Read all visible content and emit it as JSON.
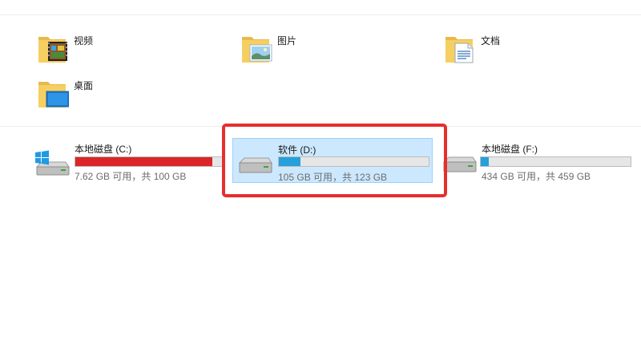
{
  "folders": [
    {
      "label": "视频",
      "icon": "video-folder-icon"
    },
    {
      "label": "图片",
      "icon": "pictures-folder-icon"
    },
    {
      "label": "文档",
      "icon": "documents-folder-icon"
    },
    {
      "label": "桌面",
      "icon": "desktop-folder-icon"
    }
  ],
  "drives": [
    {
      "name": "本地磁盘 (C:)",
      "free_text": "7.62 GB 可用，共 100 GB",
      "used_fraction": 0.924,
      "bar_color": "#da2626",
      "icon": "windows-drive-icon"
    },
    {
      "name": "软件 (D:)",
      "free_text": "105 GB 可用，共 123 GB",
      "used_fraction": 0.146,
      "bar_color": "#26a0da",
      "icon": "hard-drive-icon",
      "selected": true
    },
    {
      "name": "本地磁盘 (F:)",
      "free_text": "434 GB 可用，共 459 GB",
      "used_fraction": 0.054,
      "bar_color": "#26a0da",
      "icon": "hard-drive-icon"
    }
  ],
  "colors": {
    "selection_bg": "#cce8ff",
    "selection_border": "#99d1ff",
    "highlight_annotation": "#e62e2e"
  }
}
